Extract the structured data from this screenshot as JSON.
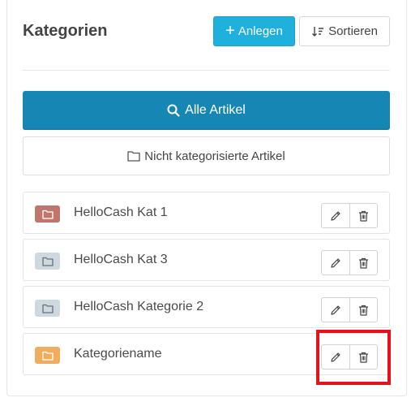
{
  "header": {
    "title": "Kategorien",
    "add_label": "Anlegen",
    "sort_label": "Sortieren"
  },
  "filters": {
    "all_label": "Alle Artikel",
    "uncategorized_label": "Nicht kategorisierte Artikel"
  },
  "categories": [
    {
      "name": "HelloCash Kat 1",
      "color": "#c1766b",
      "icon": "folder-icon"
    },
    {
      "name": "HelloCash Kat 3",
      "color": "#cdd8df",
      "icon": "folder-icon"
    },
    {
      "name": "HelloCash Kategorie 2",
      "color": "#cdd8df",
      "icon": "folder-icon"
    },
    {
      "name": "Kategoriename",
      "color": "#f0ad5e",
      "icon": "folder-icon"
    }
  ],
  "row_actions": {
    "edit_icon": "pencil-icon",
    "delete_icon": "trash-icon"
  },
  "colors": {
    "primary": "#1fb0de",
    "primary_dark": "#1687b5",
    "highlight": "#e3121b"
  }
}
